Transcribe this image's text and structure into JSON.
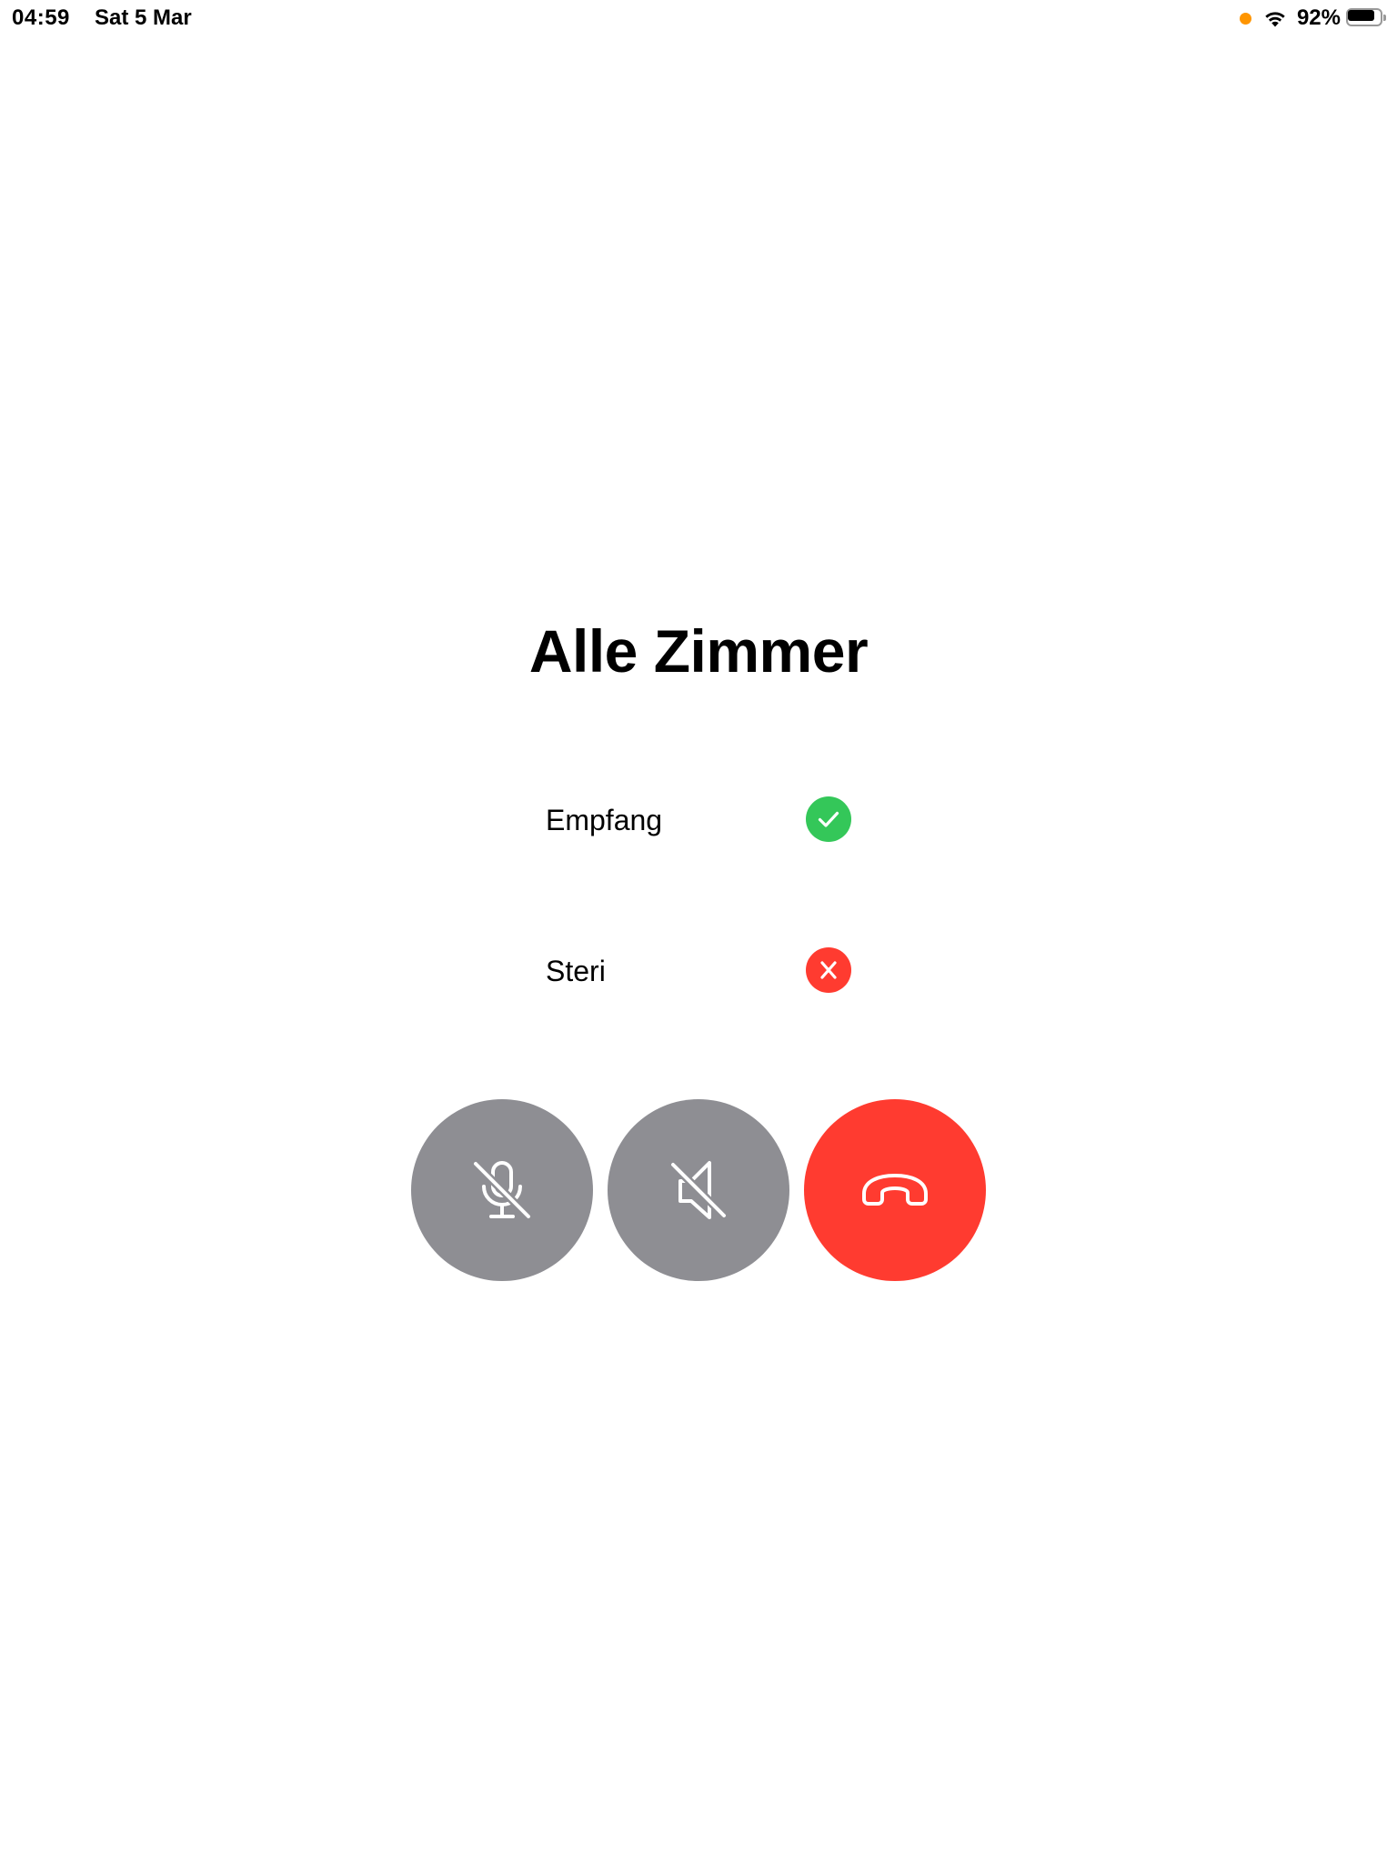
{
  "status_bar": {
    "time": "04:59",
    "date": "Sat 5 Mar",
    "battery_percent": "92%",
    "battery_level": 0.92,
    "privacy_indicator_color": "#FF9500",
    "icons": [
      "wifi-icon",
      "battery-icon"
    ]
  },
  "call": {
    "title": "Alle Zimmer",
    "participants": [
      {
        "name": "Empfang",
        "status": "connected",
        "status_icon": "checkmark-icon",
        "status_color": "#34C759"
      },
      {
        "name": "Steri",
        "status": "failed",
        "status_icon": "xmark-icon",
        "status_color": "#FF3B30"
      }
    ]
  },
  "controls": {
    "mute_microphone": {
      "icon": "microphone-slash-icon",
      "color": "#8E8E93"
    },
    "mute_speaker": {
      "icon": "speaker-slash-icon",
      "color": "#8E8E93"
    },
    "end_call": {
      "icon": "phone-down-icon",
      "color": "#FF3B30"
    }
  }
}
